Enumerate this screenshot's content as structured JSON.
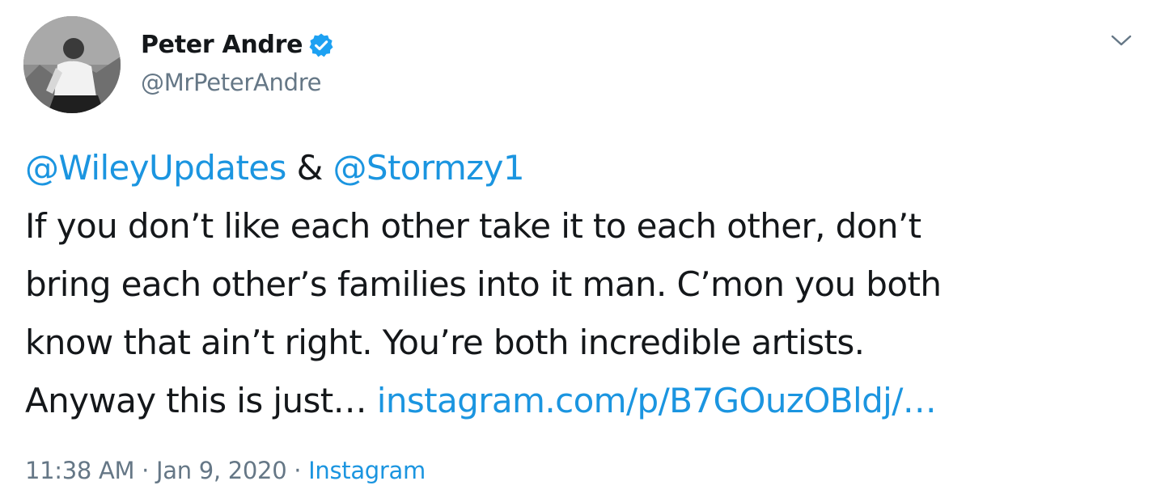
{
  "author": {
    "display_name": "Peter Andre",
    "handle": "@MrPeterAndre",
    "verified": true
  },
  "menu_icon": "chevron-down-icon",
  "tweet": {
    "mention_1": "@WileyUpdates",
    "connector": " & ",
    "mention_2": "@Stormzy1",
    "line_1": "If you don’t like each other take it to each other, don’t",
    "line_2": "bring each other’s families into it man. C’mon you both",
    "line_3": "know that ain’t right. You’re both incredible artists.",
    "line_4_text": "Anyway this is just… ",
    "link": "instagram.com/p/B7GOuzOBldj/…"
  },
  "meta": {
    "time": "11:38 AM",
    "sep_1": " · ",
    "date": "Jan 9, 2020",
    "sep_2": " · ",
    "source": "Instagram"
  },
  "colors": {
    "link": "#1b95e0",
    "secondary_text": "#657786",
    "primary_text": "#14171a"
  }
}
